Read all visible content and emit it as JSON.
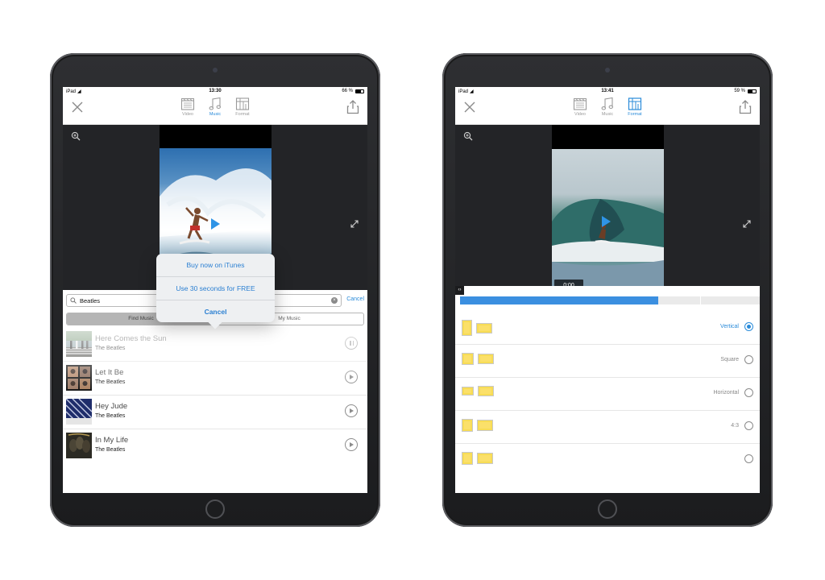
{
  "left": {
    "status": {
      "device": "iPad",
      "time": "13:30",
      "battery": "66 %",
      "battery_level": 0.66
    },
    "tabs": [
      {
        "label": "Video",
        "active": false
      },
      {
        "label": "Music",
        "active": true
      },
      {
        "label": "Format",
        "active": false
      }
    ],
    "search": {
      "value": "Beatles",
      "cancel": "Cancel"
    },
    "segments": [
      "Find Music",
      "My Music"
    ],
    "popover": {
      "options": [
        "Buy now on iTunes",
        "Use 30 seconds for FREE",
        "Cancel"
      ]
    },
    "songs": [
      {
        "title": "Here Comes the Sun",
        "artist": "The Beatles",
        "state": "pause"
      },
      {
        "title": "Let It Be",
        "artist": "The Beatles",
        "state": "play"
      },
      {
        "title": "Hey Jude",
        "artist": "The Beatles",
        "state": "play"
      },
      {
        "title": "In My Life",
        "artist": "The Beatles",
        "state": "play"
      }
    ]
  },
  "right": {
    "status": {
      "device": "iPad",
      "time": "13:41",
      "battery": "59 %",
      "battery_level": 0.59
    },
    "tabs": [
      {
        "label": "Video",
        "active": false
      },
      {
        "label": "Music",
        "active": false
      },
      {
        "label": "Format",
        "active": true
      }
    ],
    "timecode": "0:00",
    "timeline_progress": 0.66,
    "formats": [
      {
        "label": "Vertical",
        "selected": true
      },
      {
        "label": "Square",
        "selected": false
      },
      {
        "label": "Horizontal",
        "selected": false
      },
      {
        "label": "4:3",
        "selected": false
      }
    ]
  },
  "colors": {
    "accent": "#2a8bd9",
    "thumbnail_yellow": "#f7dc55",
    "player_bg": "#232427"
  }
}
